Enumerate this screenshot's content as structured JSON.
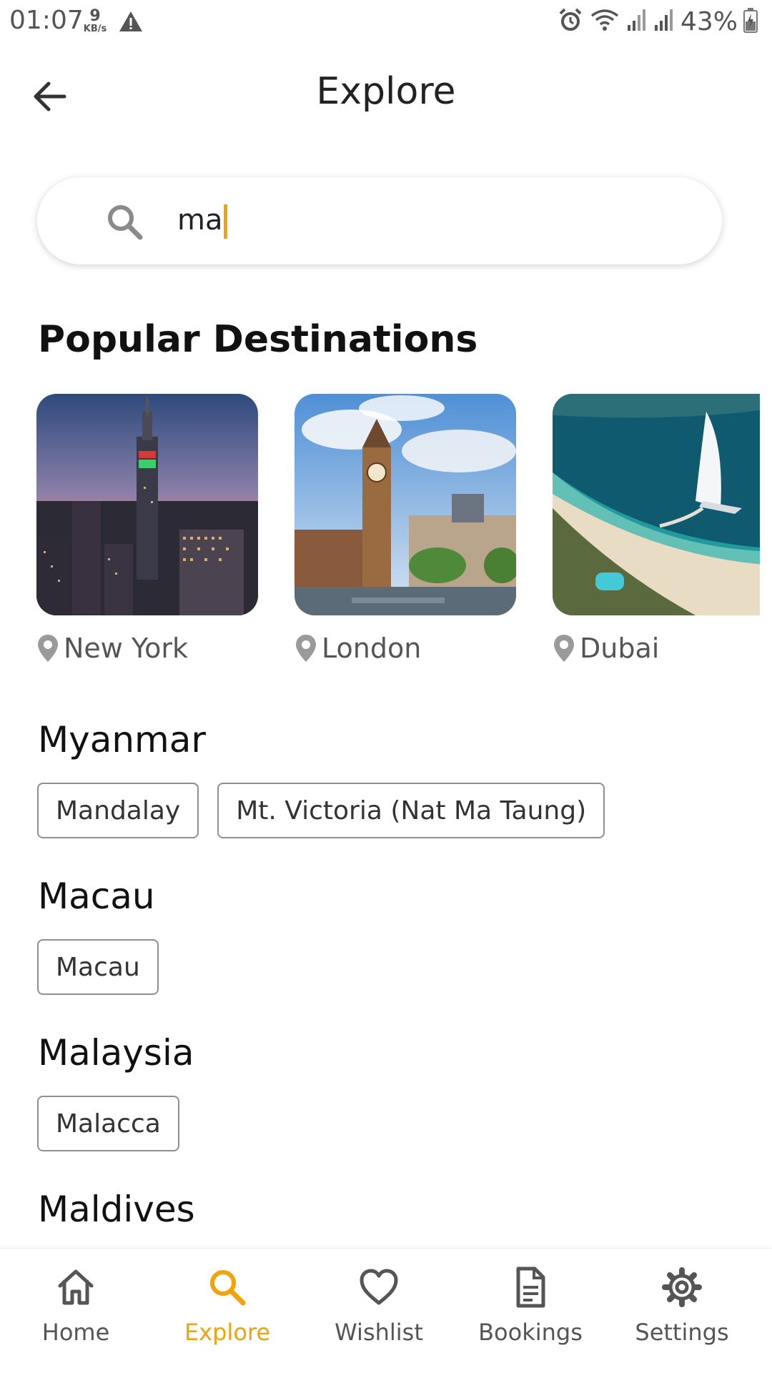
{
  "status_bar": {
    "time": "01:07",
    "net_speed_value": "9",
    "net_speed_unit": "KB/s",
    "battery": "43%",
    "icons": [
      "warning-icon",
      "alarm-icon",
      "wifi-icon",
      "signal-icon",
      "signal-icon",
      "battery-icon"
    ]
  },
  "header": {
    "title": "Explore"
  },
  "search": {
    "value": "ma"
  },
  "popular": {
    "heading": "Popular Destinations",
    "items": [
      {
        "label": "New York"
      },
      {
        "label": "London"
      },
      {
        "label": "Dubai"
      }
    ]
  },
  "results": [
    {
      "country": "Myanmar",
      "places": [
        "Mandalay",
        "Mt. Victoria (Nat Ma Taung)"
      ]
    },
    {
      "country": "Macau",
      "places": [
        "Macau"
      ]
    },
    {
      "country": "Malaysia",
      "places": [
        "Malacca"
      ]
    },
    {
      "country": "Maldives",
      "places": []
    }
  ],
  "bottom_nav": {
    "items": [
      {
        "label": "Home",
        "icon": "home-icon"
      },
      {
        "label": "Explore",
        "icon": "search-icon"
      },
      {
        "label": "Wishlist",
        "icon": "heart-icon"
      },
      {
        "label": "Bookings",
        "icon": "document-icon"
      },
      {
        "label": "Settings",
        "icon": "gear-icon"
      }
    ],
    "active_index": 1
  },
  "colors": {
    "accent": "#f2a20a",
    "text": "#111111",
    "muted": "#555555"
  }
}
